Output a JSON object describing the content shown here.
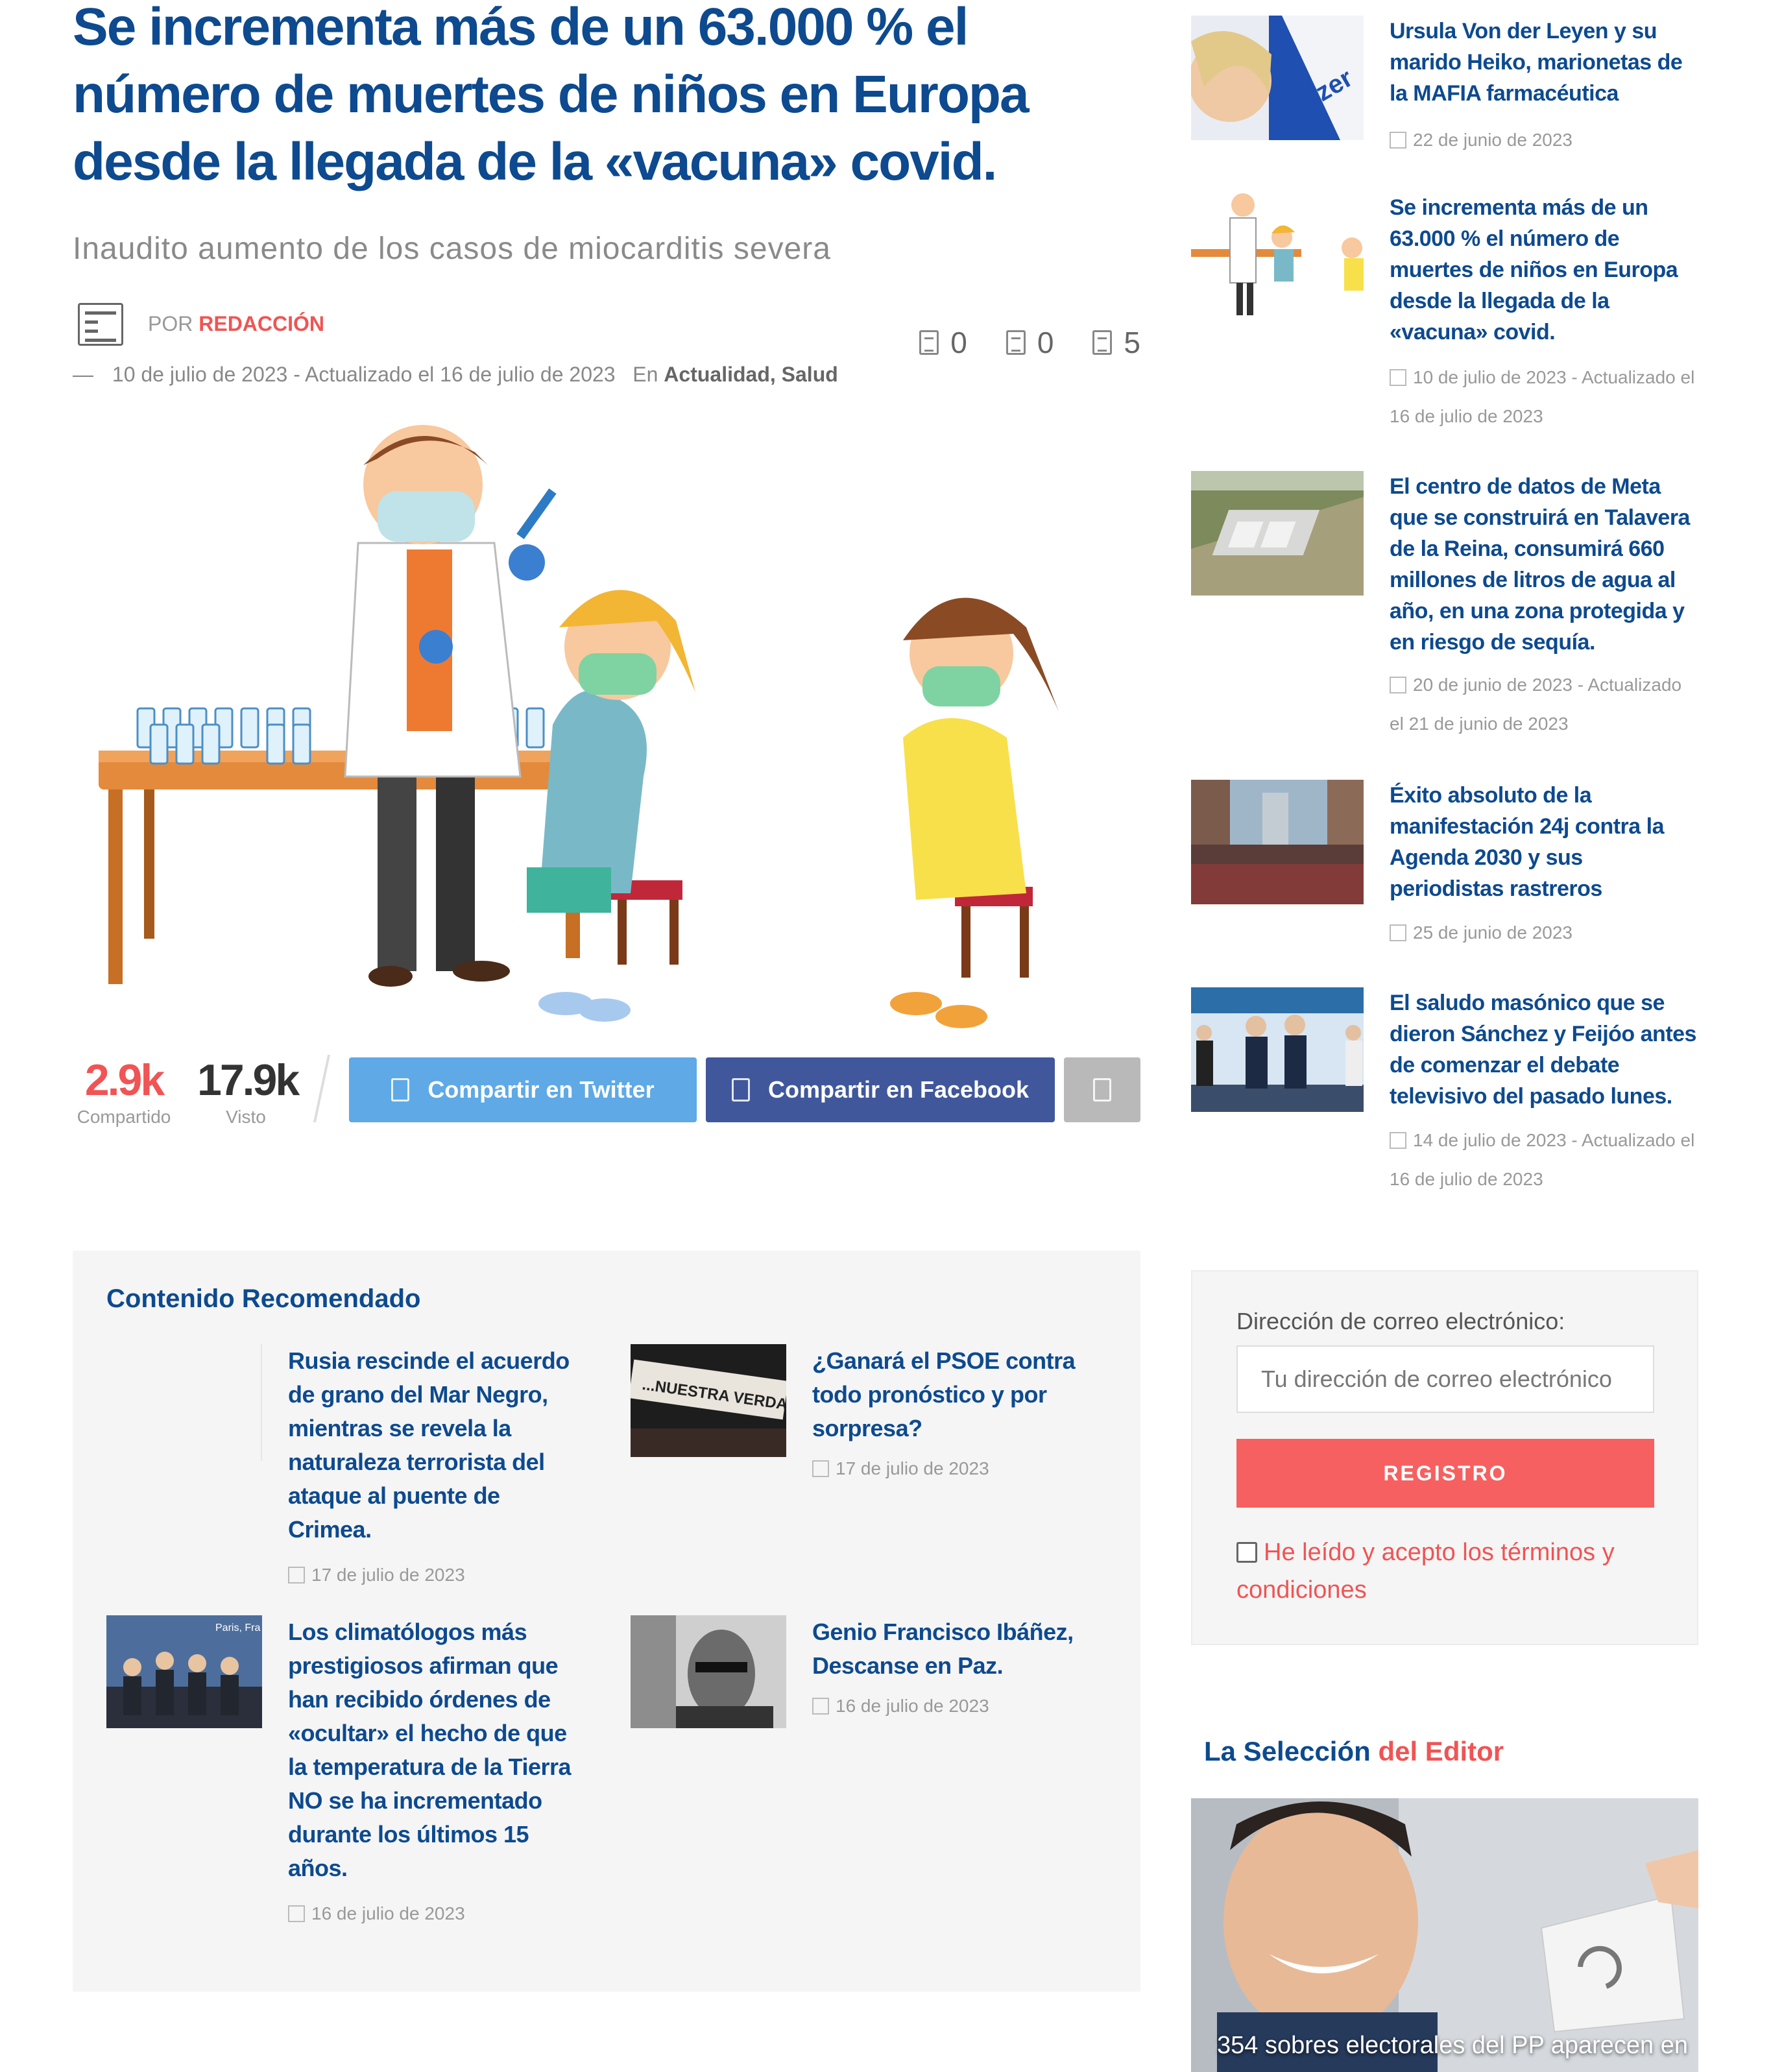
{
  "article": {
    "title": "Se incrementa más de un 63.000 % el número de muertes de niños en Europa desde la llegada de la «vacuna» covid.",
    "subtitle": "Inaudito aumento de los casos de miocarditis severa",
    "byline_prefix": "POR",
    "author": "REDACCIÓN",
    "dash": "—",
    "date": "10 de julio de 2023 - Actualizado el 16 de julio de 2023",
    "categories_prefix": "En",
    "categories": "Actualidad, Salud",
    "counters": [
      "0",
      "0",
      "5"
    ]
  },
  "share": {
    "shared_count": "2.9k",
    "shared_label": "Compartido",
    "views_count": "17.9k",
    "views_label": "Visto",
    "twitter_label": "Compartir en Twitter",
    "facebook_label": "Compartir en Facebook"
  },
  "recommended": {
    "title": "Contenido Recomendado",
    "items": [
      {
        "title": "Rusia rescinde el acuerdo de grano del Mar Negro, mientras se revela la naturaleza terrorista del ataque al puente de Crimea.",
        "date": "17 de julio de 2023"
      },
      {
        "title": "¿Ganará el PSOE contra todo pronóstico y por sorpresa?",
        "date": "17 de julio de 2023",
        "thumb_text": "...NUESTRA VERDAD"
      },
      {
        "title": "Los climatólogos más prestigiosos afirman que han recibido órdenes de «ocultar» el hecho de que la temperatura de la Tierra NO se ha incrementado durante los últimos 15 años.",
        "date": "16 de julio de 2023",
        "thumb_text": "Paris, Fra"
      },
      {
        "title": "Genio Francisco Ibáñez, Descanse en Paz.",
        "date": "16 de julio de 2023"
      }
    ]
  },
  "sidebar": {
    "items": [
      {
        "title": "Ursula Von der Leyen y su marido Heiko, marionetas de la MAFIA farmacéutica",
        "date": "22 de junio de 2023",
        "thumb_text": "Pfizer"
      },
      {
        "title": "Se incrementa más de un 63.000 % el número de muertes de niños en Europa desde la llegada de la «vacuna» covid.",
        "date": "10 de julio de 2023 - Actualizado el 16 de julio de 2023"
      },
      {
        "title": "El centro de datos de Meta que se construirá en Talavera de la Reina, consumirá 660 millones de litros de agua al año, en una zona protegida y en riesgo de sequía.",
        "date": "20 de junio de 2023 - Actualizado el 21 de junio de 2023"
      },
      {
        "title": "Éxito absoluto de la manifestación 24j contra la Agenda 2030 y sus periodistas rastreros",
        "date": "25 de junio de 2023"
      },
      {
        "title": "El saludo masónico que se dieron Sánchez y Feijóo antes de comenzar el debate televisivo del pasado lunes.",
        "date": "14 de julio de 2023 - Actualizado el 16 de julio de 2023"
      }
    ]
  },
  "newsletter": {
    "label": "Dirección de correo electrónico:",
    "placeholder": "Tu dirección de correo electrónico",
    "button": "REGISTRO",
    "terms": "He leído y acepto los términos y condiciones"
  },
  "editor": {
    "title_part1": "La Selección",
    "title_part2": "del Editor",
    "caption": "354 sobres electorales del PP aparecen en"
  },
  "colors": {
    "title_blue": "#0d4a8f",
    "accent_red": "#f05454",
    "twitter_blue": "#5ea9e6",
    "facebook_blue": "#40579b",
    "panel_gray": "#f5f5f5"
  }
}
